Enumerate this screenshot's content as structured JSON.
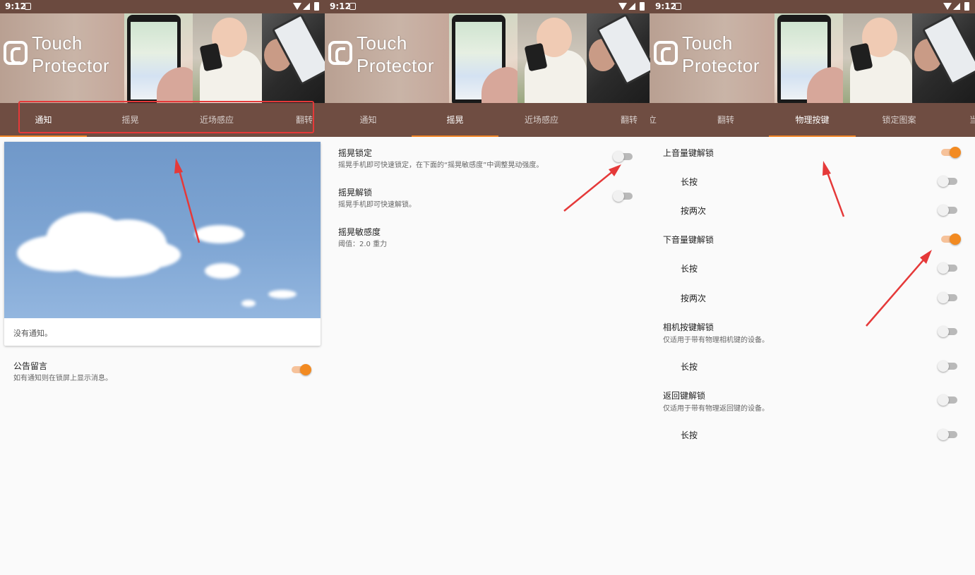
{
  "status_bar": {
    "time": "9:12"
  },
  "banner": {
    "logo_line1": "Touch",
    "logo_line2": "Protector"
  },
  "panel_notification": {
    "tabs": [
      "通知",
      "摇晃",
      "近场感应",
      "翻转"
    ],
    "active_tab": "通知",
    "card_text": "没有通知。",
    "setting": {
      "title": "公告留言",
      "subtitle": "如有通知则在锁屏上显示消息。",
      "on": true
    }
  },
  "panel_shake": {
    "tabs": [
      "通知",
      "摇晃",
      "近场感应",
      "翻转"
    ],
    "active_tab": "摇晃",
    "settings": [
      {
        "title": "摇晃锁定",
        "subtitle": "摇晃手机即可快速锁定，在下面的“摇晃敏感度”中调整晃动强度。",
        "on": false
      },
      {
        "title": "摇晃解锁",
        "subtitle": "摇晃手机即可快速解锁。",
        "on": false
      },
      {
        "title": "摇晃敏感度",
        "subtitle": "阈值：2.0 重力"
      }
    ]
  },
  "panel_buttons": {
    "tabs": [
      "立",
      "翻转",
      "物理按键",
      "锁定图案",
      "当"
    ],
    "active_tab": "物理按键",
    "settings": [
      {
        "title": "上音量键解锁",
        "on": true
      },
      {
        "title": "长按",
        "on": false
      },
      {
        "title": "按两次",
        "on": false
      },
      {
        "title": "下音量键解锁",
        "on": true
      },
      {
        "title": "长按",
        "on": false
      },
      {
        "title": "按两次",
        "on": false
      },
      {
        "title": "相机按键解锁",
        "subtitle": "仅适用于带有物理相机键的设备。",
        "on": false
      },
      {
        "title": "长按",
        "on": false
      },
      {
        "title": "返回键解锁",
        "subtitle": "仅适用于带有物理返回键的设备。",
        "on": false
      },
      {
        "title": "长按",
        "on": false
      }
    ]
  },
  "colors": {
    "status_bar": "#6b4a3f",
    "tab_bar": "#6f4d42",
    "accent": "#ef8424",
    "annotation": "#e53939"
  }
}
